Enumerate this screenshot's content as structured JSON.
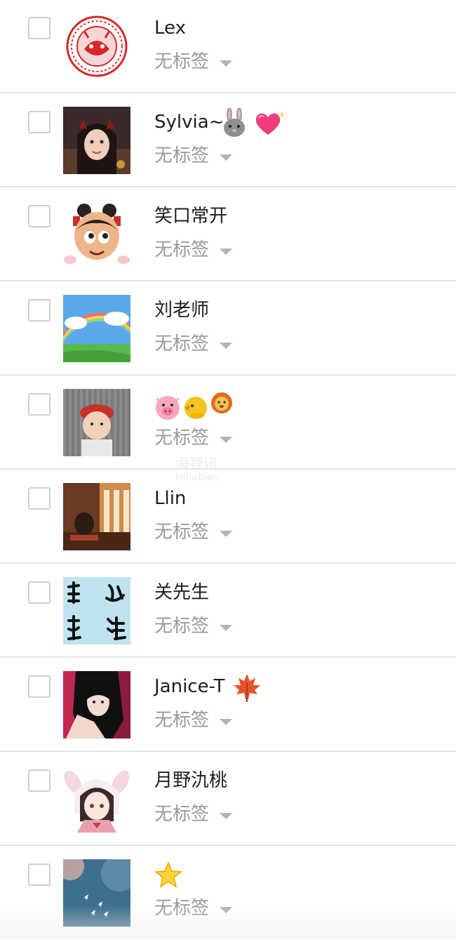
{
  "contacts": [
    {
      "name": "Lex",
      "tag": "无标签",
      "avatar": "red-papercut-seal",
      "emojis": []
    },
    {
      "name": "Sylvia~",
      "tag": "无标签",
      "avatar": "girl-selfie-photo",
      "emojis": [
        "rabbit-face-emoji",
        "sparkling-heart-emoji"
      ]
    },
    {
      "name": "笑口常开",
      "tag": "无标签",
      "avatar": "cartoon-girl-buns",
      "emojis": []
    },
    {
      "name": "刘老师",
      "tag": "无标签",
      "avatar": "rainbow-landscape",
      "emojis": []
    },
    {
      "name": "",
      "tag": "无标签",
      "avatar": "child-red-hat-photo",
      "emojis": [
        "pig-face-emoji",
        "baby-chick-emoji",
        "lion-face-emoji"
      ]
    },
    {
      "name": "Llin",
      "tag": "无标签",
      "avatar": "cafe-interior-photo",
      "emojis": []
    },
    {
      "name": "关先生",
      "tag": "无标签",
      "avatar": "calligraphy-xinjing-yiding",
      "emojis": []
    },
    {
      "name": "Janice-T",
      "tag": "无标签",
      "avatar": "anime-dark-hair-girl",
      "emojis": [
        "maple-leaf-emoji"
      ]
    },
    {
      "name": "月野氿桃",
      "tag": "无标签",
      "avatar": "anime-bunny-hood-girl",
      "emojis": []
    },
    {
      "name": "",
      "tag": "无标签",
      "avatar": "blue-water-photo",
      "emojis": [
        "star-emoji"
      ]
    }
  ],
  "colors": {
    "name_text": "#1e1e1e",
    "tag_text": "#9a9a9a",
    "divider": "#e6e6e6",
    "checkbox_border": "#cfcfcf"
  }
}
